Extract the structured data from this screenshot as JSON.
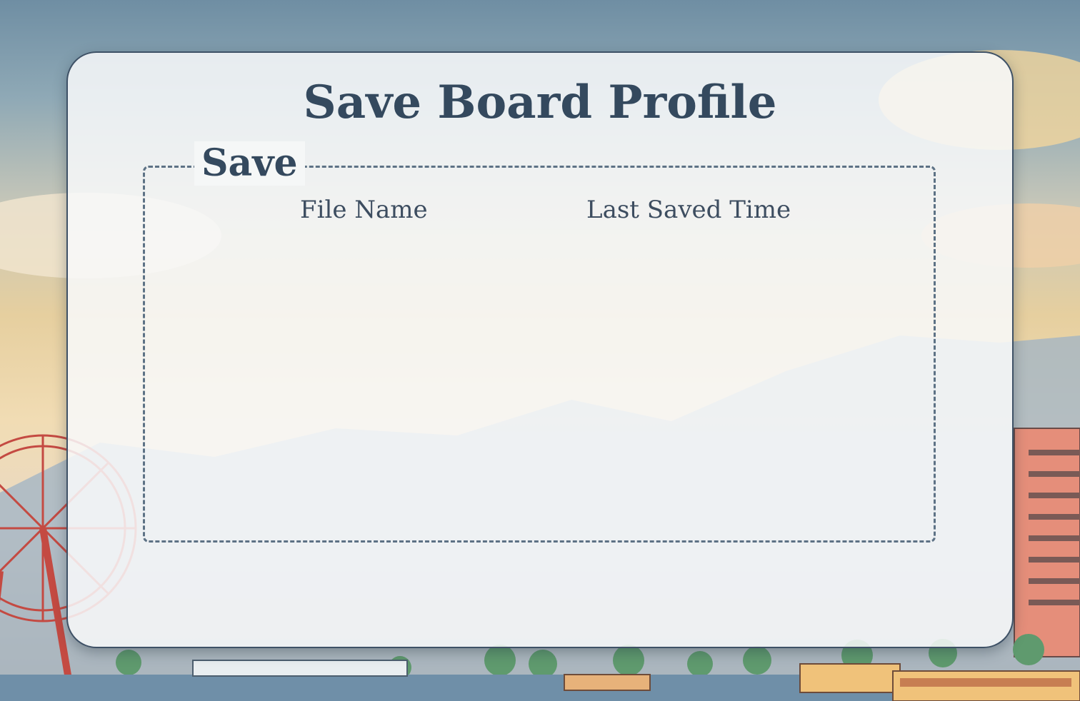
{
  "dialog": {
    "title": "Save Board Profile"
  },
  "save_section": {
    "legend": "Save",
    "columns": [
      {
        "label": "File Name"
      },
      {
        "label": "Last Saved Time"
      }
    ],
    "rows": []
  },
  "colors": {
    "text": "#34495e",
    "border": "#5d7285",
    "modal_border": "#3e5166"
  }
}
